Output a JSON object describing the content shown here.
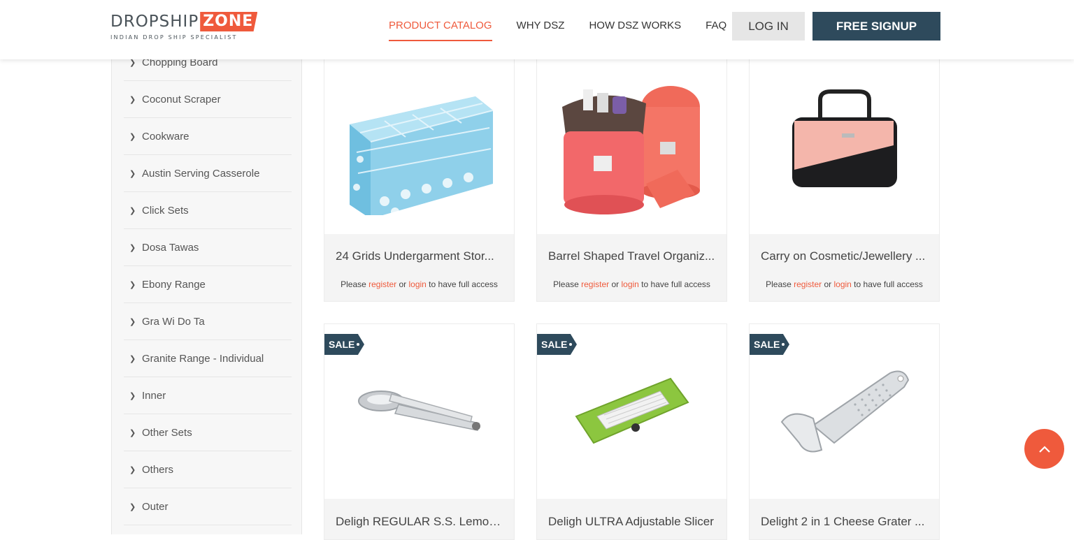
{
  "brand": {
    "name_part1": "DROPSHIP",
    "name_part2": "ZONE",
    "tagline": "INDIAN DROP SHIP SPECIALIST"
  },
  "nav": {
    "items": [
      "PRODUCT CATALOG",
      "WHY DSZ",
      "HOW DSZ WORKS",
      "FAQ"
    ],
    "active": "PRODUCT CATALOG",
    "login_label": "LOG IN",
    "signup_label": "FREE SIGNUP"
  },
  "sidebar": {
    "items": [
      "Chopping Board",
      "Coconut Scraper",
      "Cookware",
      "Austin Serving Casserole",
      "Click Sets",
      "Dosa Tawas",
      "Ebony Range",
      "Gra Wi Do Ta",
      "Granite Range - Individual",
      "Inner",
      "Other Sets",
      "Others",
      "Outer"
    ]
  },
  "products": [
    {
      "title": "24 Grids Undergarment Stor...",
      "sale": false,
      "access_prefix": "Please ",
      "register": "register",
      "mid": " or ",
      "login": "login",
      "access_suffix": " to have full access"
    },
    {
      "title": "Barrel Shaped Travel Organiz...",
      "sale": false,
      "access_prefix": "Please ",
      "register": "register",
      "mid": " or ",
      "login": "login",
      "access_suffix": " to have full access"
    },
    {
      "title": "Carry on Cosmetic/Jewellery ...",
      "sale": false,
      "access_prefix": "Please ",
      "register": "register",
      "mid": " or ",
      "login": "login",
      "access_suffix": " to have full access"
    },
    {
      "title": "Deligh REGULAR S.S. Lemon ...",
      "sale": true,
      "sale_label": "SALE"
    },
    {
      "title": "Deligh ULTRA Adjustable Slicer",
      "sale": true,
      "sale_label": "SALE"
    },
    {
      "title": "Delight 2 in 1 Cheese Grater ...",
      "sale": true,
      "sale_label": "SALE"
    }
  ],
  "colors": {
    "accent": "#ef5a3c",
    "navy": "#2e4a5c"
  }
}
